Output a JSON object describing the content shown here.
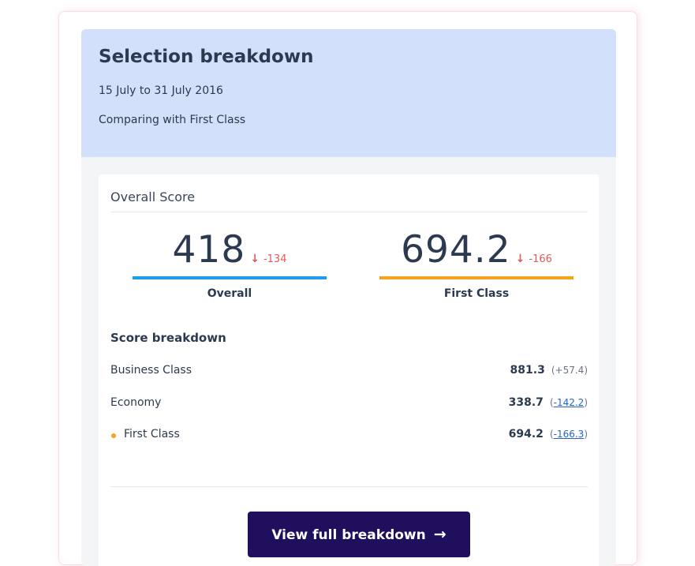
{
  "header": {
    "title": "Selection breakdown",
    "date_range": "15 July to 31 July 2016",
    "comparing": "Comparing with First Class"
  },
  "overall_score": {
    "section_label": "Overall Score",
    "scores": [
      {
        "value": "418",
        "delta": "-134",
        "caption": "Overall",
        "bar_color": "#1b9ef0",
        "delta_icon": "arrow-down-icon"
      },
      {
        "value": "694.2",
        "delta": "-166",
        "caption": "First Class",
        "bar_color": "#f5a11c",
        "delta_icon": "arrow-down-icon"
      }
    ]
  },
  "breakdown": {
    "heading": "Score breakdown",
    "rows": [
      {
        "name": "Business Class",
        "value": "881.3",
        "diff": "+57.4",
        "diff_is_link": false,
        "marker": ""
      },
      {
        "name": "Economy",
        "value": "338.7",
        "diff": "-142.2",
        "diff_is_link": true,
        "marker": ""
      },
      {
        "name": "First Class",
        "value": "694.2",
        "diff": "-166.3",
        "diff_is_link": true,
        "marker": "orange-dot"
      }
    ]
  },
  "cta": {
    "label": "View full breakdown",
    "icon": "arrow-right-icon"
  },
  "colors": {
    "header_bg": "#d2e0fb",
    "negative_delta": "#e05a5a",
    "button_bg": "#1f0f5c",
    "link": "#2463c9"
  }
}
